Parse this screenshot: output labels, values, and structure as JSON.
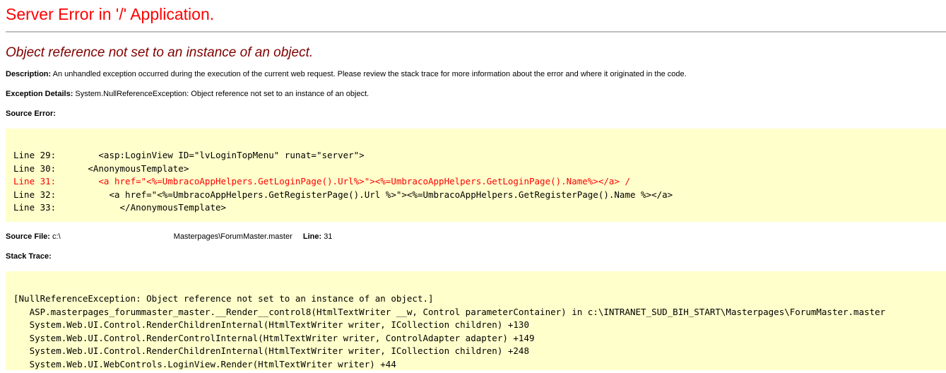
{
  "title": "Server Error in '/' Application.",
  "subtitle": "Object reference not set to an instance of an object.",
  "description": {
    "label": "Description:",
    "text": "An unhandled exception occurred during the execution of the current web request. Please review the stack trace for more information about the error and where it originated in the code."
  },
  "exception": {
    "label": "Exception Details:",
    "text": "System.NullReferenceException: Object reference not set to an instance of an object."
  },
  "source_error": {
    "label": "Source Error:",
    "lines": [
      {
        "text": "Line 29:        <asp:LoginView ID=\"lvLoginTopMenu\" runat=\"server\">"
      },
      {
        "text": "Line 30:      <AnonymousTemplate>"
      },
      {
        "text": "Line 31:        <a href=\"<%=UmbracoAppHelpers.GetLoginPage().Url%>\"><%=UmbracoAppHelpers.GetLoginPage().Name%></a> /"
      },
      {
        "text": "Line 32:          <a href=\"<%=UmbracoAppHelpers.GetRegisterPage().Url %>\"><%=UmbracoAppHelpers.GetRegisterPage().Name %></a>"
      },
      {
        "text": "Line 33:            </AnonymousTemplate>"
      }
    ]
  },
  "source_file": {
    "label": "Source File:",
    "path_prefix": "c:\\",
    "path_suffix": "Masterpages\\ForumMaster.master",
    "line_label": "Line:",
    "line_value": "31"
  },
  "stack_trace": {
    "label": "Stack Trace:",
    "lines": [
      {
        "text": "[NullReferenceException: Object reference not set to an instance of an object.]"
      },
      {
        "text": "   ASP.masterpages_forummaster_master.__Render__control8(HtmlTextWriter __w, Control parameterContainer) in c:\\INTRANET_SUD_BIH_START\\Masterpages\\ForumMaster.master"
      },
      {
        "text": "   System.Web.UI.Control.RenderChildrenInternal(HtmlTextWriter writer, ICollection children) +130"
      },
      {
        "text": "   System.Web.UI.Control.RenderControlInternal(HtmlTextWriter writer, ControlAdapter adapter) +149"
      },
      {
        "text": "   System.Web.UI.Control.RenderChildrenInternal(HtmlTextWriter writer, ICollection children) +248"
      },
      {
        "text": "   System.Web.UI.WebControls.LoginView.Render(HtmlTextWriter writer) +44"
      }
    ]
  },
  "colors": {
    "title": "#ff0000",
    "subtitle": "#800000",
    "code_background": "#ffffcc",
    "error_line": "#ff0000"
  }
}
